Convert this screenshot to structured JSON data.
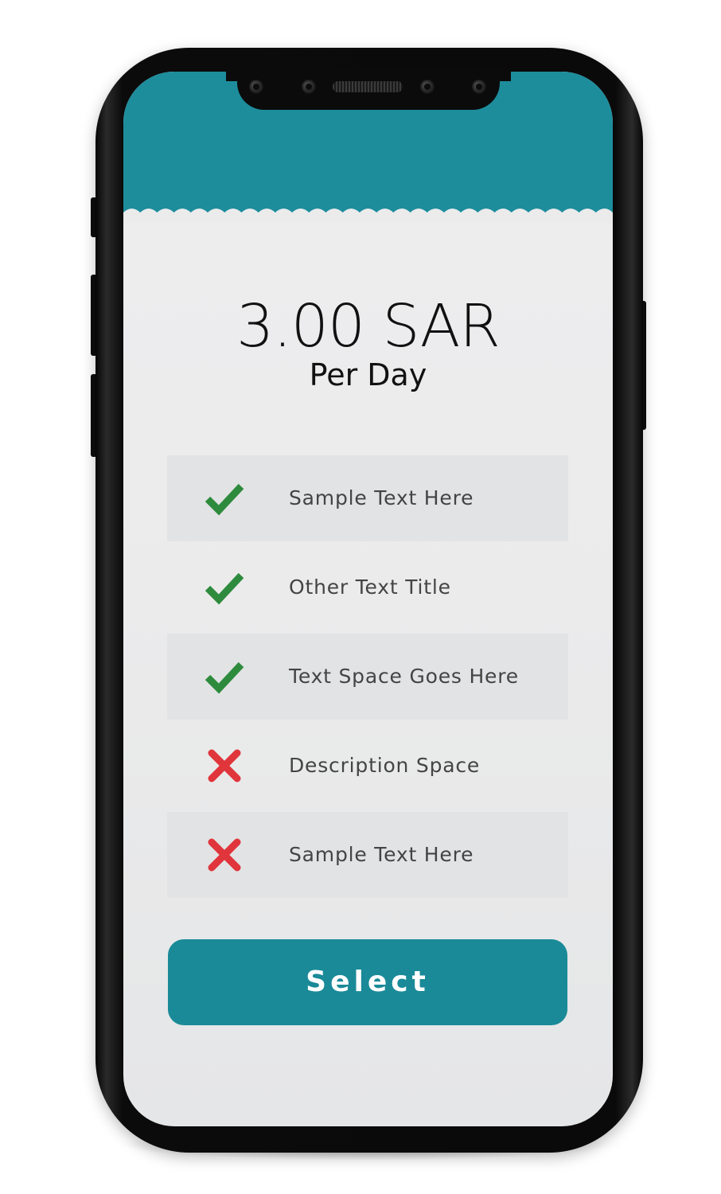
{
  "pricing": {
    "price": "3.00 SAR",
    "period": "Per Day"
  },
  "features": [
    {
      "label": "Sample Text Here",
      "included": true,
      "icon": "check-icon"
    },
    {
      "label": "Other Text Title",
      "included": true,
      "icon": "check-icon"
    },
    {
      "label": "Text Space Goes Here",
      "included": true,
      "icon": "check-icon"
    },
    {
      "label": "Description Space",
      "included": false,
      "icon": "cross-icon"
    },
    {
      "label": "Sample Text Here",
      "included": false,
      "icon": "cross-icon"
    }
  ],
  "actions": {
    "select_label": "Select"
  },
  "colors": {
    "accent": "#1d8d9c",
    "check": "#2e8b3d",
    "cross": "#e0353b",
    "text": "#444444",
    "row_shade": "#e2e3e5"
  }
}
